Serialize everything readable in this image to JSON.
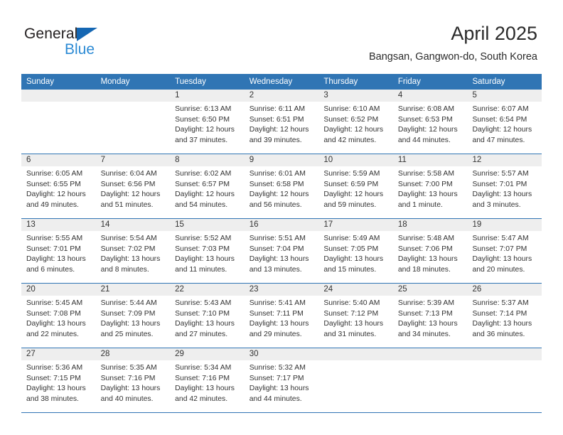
{
  "brand": {
    "name_part1": "General",
    "name_part2": "Blue",
    "triangle_color": "#1567b3",
    "blue_color": "#2b8ad4"
  },
  "header": {
    "title": "April 2025",
    "subtitle": "Bangsan, Gangwon-do, South Korea"
  },
  "theme": {
    "header_blue": "#3075b4",
    "daynum_band": "#eeeeee",
    "text": "#333333"
  },
  "weekdays": [
    "Sunday",
    "Monday",
    "Tuesday",
    "Wednesday",
    "Thursday",
    "Friday",
    "Saturday"
  ],
  "weeks": [
    [
      {
        "day": "",
        "empty": true,
        "sunrise": "",
        "sunset": "",
        "daylight_a": "",
        "daylight_b": ""
      },
      {
        "day": "",
        "empty": true,
        "sunrise": "",
        "sunset": "",
        "daylight_a": "",
        "daylight_b": ""
      },
      {
        "day": "1",
        "sunrise": "Sunrise: 6:13 AM",
        "sunset": "Sunset: 6:50 PM",
        "daylight_a": "Daylight: 12 hours",
        "daylight_b": "and 37 minutes."
      },
      {
        "day": "2",
        "sunrise": "Sunrise: 6:11 AM",
        "sunset": "Sunset: 6:51 PM",
        "daylight_a": "Daylight: 12 hours",
        "daylight_b": "and 39 minutes."
      },
      {
        "day": "3",
        "sunrise": "Sunrise: 6:10 AM",
        "sunset": "Sunset: 6:52 PM",
        "daylight_a": "Daylight: 12 hours",
        "daylight_b": "and 42 minutes."
      },
      {
        "day": "4",
        "sunrise": "Sunrise: 6:08 AM",
        "sunset": "Sunset: 6:53 PM",
        "daylight_a": "Daylight: 12 hours",
        "daylight_b": "and 44 minutes."
      },
      {
        "day": "5",
        "sunrise": "Sunrise: 6:07 AM",
        "sunset": "Sunset: 6:54 PM",
        "daylight_a": "Daylight: 12 hours",
        "daylight_b": "and 47 minutes."
      }
    ],
    [
      {
        "day": "6",
        "sunrise": "Sunrise: 6:05 AM",
        "sunset": "Sunset: 6:55 PM",
        "daylight_a": "Daylight: 12 hours",
        "daylight_b": "and 49 minutes."
      },
      {
        "day": "7",
        "sunrise": "Sunrise: 6:04 AM",
        "sunset": "Sunset: 6:56 PM",
        "daylight_a": "Daylight: 12 hours",
        "daylight_b": "and 51 minutes."
      },
      {
        "day": "8",
        "sunrise": "Sunrise: 6:02 AM",
        "sunset": "Sunset: 6:57 PM",
        "daylight_a": "Daylight: 12 hours",
        "daylight_b": "and 54 minutes."
      },
      {
        "day": "9",
        "sunrise": "Sunrise: 6:01 AM",
        "sunset": "Sunset: 6:58 PM",
        "daylight_a": "Daylight: 12 hours",
        "daylight_b": "and 56 minutes."
      },
      {
        "day": "10",
        "sunrise": "Sunrise: 5:59 AM",
        "sunset": "Sunset: 6:59 PM",
        "daylight_a": "Daylight: 12 hours",
        "daylight_b": "and 59 minutes."
      },
      {
        "day": "11",
        "sunrise": "Sunrise: 5:58 AM",
        "sunset": "Sunset: 7:00 PM",
        "daylight_a": "Daylight: 13 hours",
        "daylight_b": "and 1 minute."
      },
      {
        "day": "12",
        "sunrise": "Sunrise: 5:57 AM",
        "sunset": "Sunset: 7:01 PM",
        "daylight_a": "Daylight: 13 hours",
        "daylight_b": "and 3 minutes."
      }
    ],
    [
      {
        "day": "13",
        "sunrise": "Sunrise: 5:55 AM",
        "sunset": "Sunset: 7:01 PM",
        "daylight_a": "Daylight: 13 hours",
        "daylight_b": "and 6 minutes."
      },
      {
        "day": "14",
        "sunrise": "Sunrise: 5:54 AM",
        "sunset": "Sunset: 7:02 PM",
        "daylight_a": "Daylight: 13 hours",
        "daylight_b": "and 8 minutes."
      },
      {
        "day": "15",
        "sunrise": "Sunrise: 5:52 AM",
        "sunset": "Sunset: 7:03 PM",
        "daylight_a": "Daylight: 13 hours",
        "daylight_b": "and 11 minutes."
      },
      {
        "day": "16",
        "sunrise": "Sunrise: 5:51 AM",
        "sunset": "Sunset: 7:04 PM",
        "daylight_a": "Daylight: 13 hours",
        "daylight_b": "and 13 minutes."
      },
      {
        "day": "17",
        "sunrise": "Sunrise: 5:49 AM",
        "sunset": "Sunset: 7:05 PM",
        "daylight_a": "Daylight: 13 hours",
        "daylight_b": "and 15 minutes."
      },
      {
        "day": "18",
        "sunrise": "Sunrise: 5:48 AM",
        "sunset": "Sunset: 7:06 PM",
        "daylight_a": "Daylight: 13 hours",
        "daylight_b": "and 18 minutes."
      },
      {
        "day": "19",
        "sunrise": "Sunrise: 5:47 AM",
        "sunset": "Sunset: 7:07 PM",
        "daylight_a": "Daylight: 13 hours",
        "daylight_b": "and 20 minutes."
      }
    ],
    [
      {
        "day": "20",
        "sunrise": "Sunrise: 5:45 AM",
        "sunset": "Sunset: 7:08 PM",
        "daylight_a": "Daylight: 13 hours",
        "daylight_b": "and 22 minutes."
      },
      {
        "day": "21",
        "sunrise": "Sunrise: 5:44 AM",
        "sunset": "Sunset: 7:09 PM",
        "daylight_a": "Daylight: 13 hours",
        "daylight_b": "and 25 minutes."
      },
      {
        "day": "22",
        "sunrise": "Sunrise: 5:43 AM",
        "sunset": "Sunset: 7:10 PM",
        "daylight_a": "Daylight: 13 hours",
        "daylight_b": "and 27 minutes."
      },
      {
        "day": "23",
        "sunrise": "Sunrise: 5:41 AM",
        "sunset": "Sunset: 7:11 PM",
        "daylight_a": "Daylight: 13 hours",
        "daylight_b": "and 29 minutes."
      },
      {
        "day": "24",
        "sunrise": "Sunrise: 5:40 AM",
        "sunset": "Sunset: 7:12 PM",
        "daylight_a": "Daylight: 13 hours",
        "daylight_b": "and 31 minutes."
      },
      {
        "day": "25",
        "sunrise": "Sunrise: 5:39 AM",
        "sunset": "Sunset: 7:13 PM",
        "daylight_a": "Daylight: 13 hours",
        "daylight_b": "and 34 minutes."
      },
      {
        "day": "26",
        "sunrise": "Sunrise: 5:37 AM",
        "sunset": "Sunset: 7:14 PM",
        "daylight_a": "Daylight: 13 hours",
        "daylight_b": "and 36 minutes."
      }
    ],
    [
      {
        "day": "27",
        "sunrise": "Sunrise: 5:36 AM",
        "sunset": "Sunset: 7:15 PM",
        "daylight_a": "Daylight: 13 hours",
        "daylight_b": "and 38 minutes."
      },
      {
        "day": "28",
        "sunrise": "Sunrise: 5:35 AM",
        "sunset": "Sunset: 7:16 PM",
        "daylight_a": "Daylight: 13 hours",
        "daylight_b": "and 40 minutes."
      },
      {
        "day": "29",
        "sunrise": "Sunrise: 5:34 AM",
        "sunset": "Sunset: 7:16 PM",
        "daylight_a": "Daylight: 13 hours",
        "daylight_b": "and 42 minutes."
      },
      {
        "day": "30",
        "sunrise": "Sunrise: 5:32 AM",
        "sunset": "Sunset: 7:17 PM",
        "daylight_a": "Daylight: 13 hours",
        "daylight_b": "and 44 minutes."
      },
      {
        "day": "",
        "empty": true,
        "sunrise": "",
        "sunset": "",
        "daylight_a": "",
        "daylight_b": ""
      },
      {
        "day": "",
        "empty": true,
        "sunrise": "",
        "sunset": "",
        "daylight_a": "",
        "daylight_b": ""
      },
      {
        "day": "",
        "empty": true,
        "sunrise": "",
        "sunset": "",
        "daylight_a": "",
        "daylight_b": ""
      }
    ]
  ]
}
